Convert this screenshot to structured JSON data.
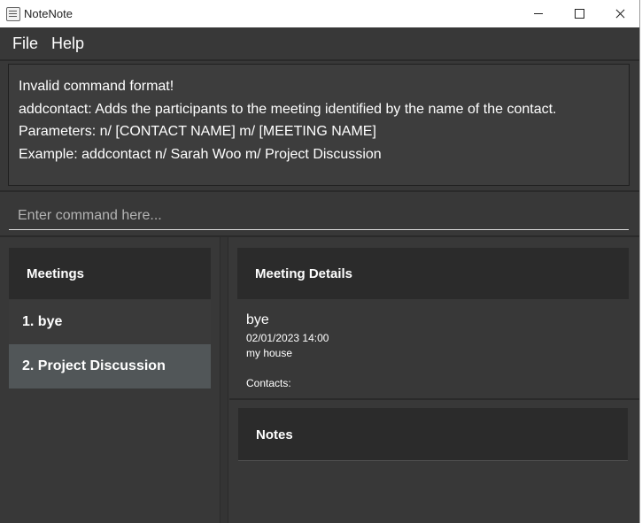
{
  "window": {
    "title": "NoteNote"
  },
  "menu": {
    "file": "File",
    "help": "Help"
  },
  "result": {
    "lines": [
      "Invalid command format!",
      "addcontact: Adds the participants to the meeting identified by the name of the contact.",
      "Parameters: n/ [CONTACT NAME] m/ [MEETING NAME]",
      "Example: addcontact n/ Sarah Woo m/ Project Discussion"
    ]
  },
  "command": {
    "placeholder": "Enter command here...",
    "value": ""
  },
  "meetings": {
    "header": "Meetings",
    "items": [
      {
        "label": "1.  bye",
        "selected": false
      },
      {
        "label": "2.  Project Discussion",
        "selected": true
      }
    ]
  },
  "details": {
    "header": "Meeting Details",
    "name": "bye",
    "datetime": "02/01/2023 14:00",
    "location": "my house",
    "contacts_label": "Contacts:"
  },
  "notes": {
    "header": "Notes"
  },
  "colors": {
    "background": "#383838",
    "panel_header": "#2b2b2b",
    "selected_row": "#515658"
  }
}
